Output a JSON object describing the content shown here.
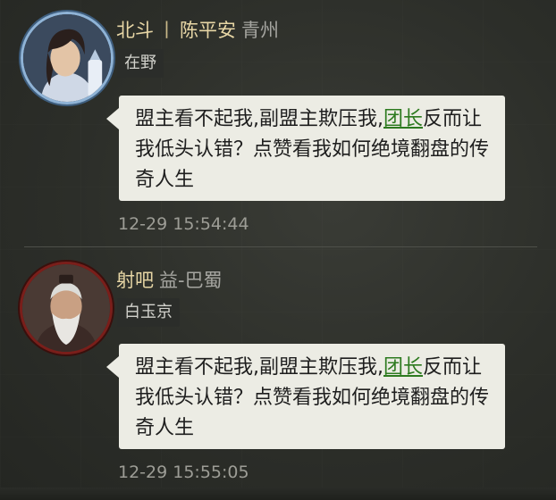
{
  "messages": [
    {
      "sender_name": "北斗丨陈平安",
      "sender_name_part1": "北斗",
      "separator": "丨",
      "sender_name_part2": "陈平安",
      "region": "青州",
      "faction_tag": "在野",
      "text_before_link": "盟主看不起我,副盟主欺压我,",
      "link_text": "团长",
      "text_after_link": "反而让我低头认错？点赞看我如何绝境翻盘的传奇人生",
      "timestamp": "12-29 15:54:44",
      "avatar_icon": "young-swordsman-portrait"
    },
    {
      "sender_name": "射吧",
      "region": "益-巴蜀",
      "faction_tag": "白玉京",
      "text_before_link": "盟主看不起我,副盟主欺压我,",
      "link_text": "团长",
      "text_after_link": "反而让我低头认错？点赞看我如何绝境翻盘的传奇人生",
      "timestamp": "12-29 15:55:05",
      "avatar_icon": "old-general-portrait"
    }
  ],
  "colors": {
    "name": "#e7d6a5",
    "link": "#2d7a1f",
    "bubble": "#ecece4",
    "timestamp": "#9d9d96"
  }
}
